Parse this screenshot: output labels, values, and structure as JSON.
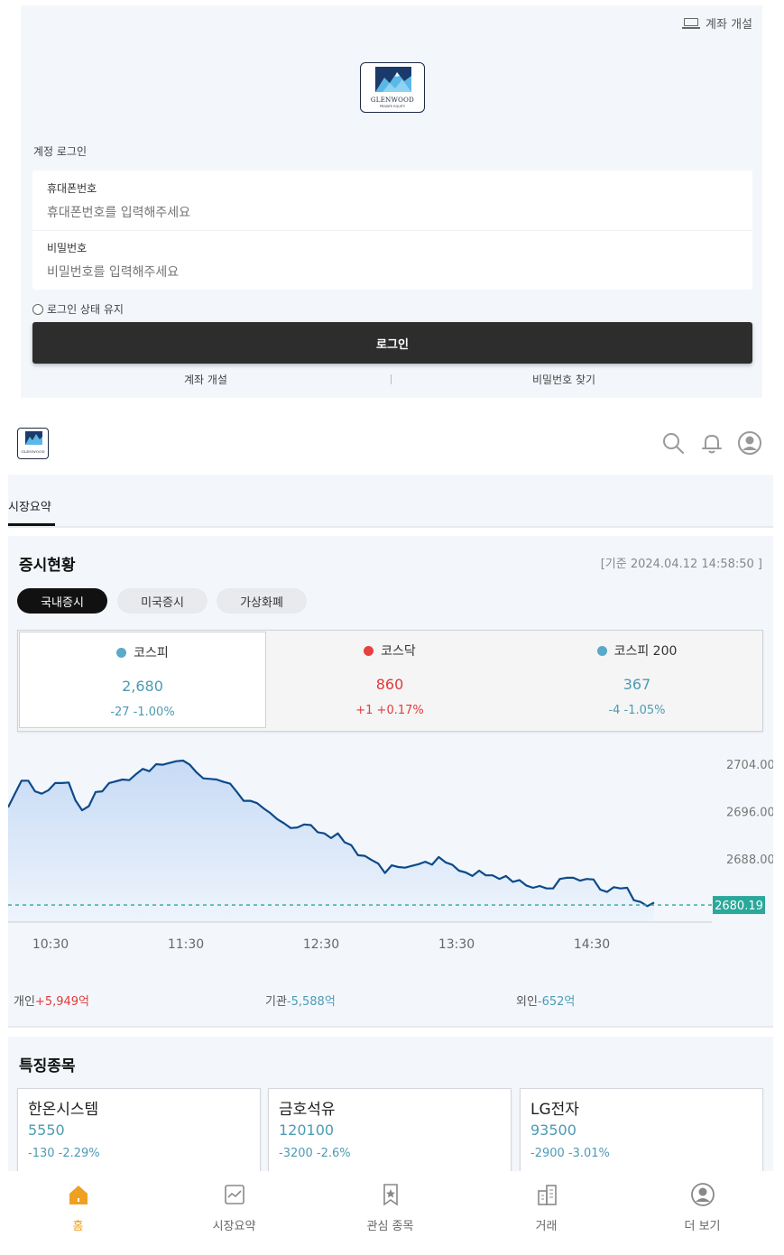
{
  "login": {
    "open_account_top": "계좌 개설",
    "logo_text": "GLENWOOD",
    "logo_subtext": "PRIVATE EQUITY",
    "heading": "계정 로그인",
    "phone_label": "휴대폰번호",
    "phone_placeholder": "휴대폰번호를 입력해주세요",
    "password_label": "비밀번호",
    "password_placeholder": "비밀번호를 입력해주세요",
    "keep_login": "로그인 상태 유지",
    "login_button": "로그인",
    "open_account_link": "계좌 개설",
    "find_password_link": "비밀번호 찾기"
  },
  "tabs": {
    "market_summary": "시장요약"
  },
  "market": {
    "title": "증시현황",
    "timestamp": "[기준 2024.04.12 14:58:50 ]",
    "pills": [
      "국내증시",
      "미국증시",
      "가상화폐"
    ],
    "indices": [
      {
        "name": "코스피",
        "value": "2,680",
        "change": "-27 -1.00%",
        "color": "#5aa9c9"
      },
      {
        "name": "코스닥",
        "value": "860",
        "change": "+1 +0.17%",
        "color": "#e84040"
      },
      {
        "name": "코스피 200",
        "value": "367",
        "change": "-4 -1.05%",
        "color": "#5aa9c9"
      }
    ],
    "flows": {
      "individual_label": "개인",
      "individual_value": "+5,949억",
      "institution_label": "기관",
      "institution_value": "-5,588억",
      "foreign_label": "외인",
      "foreign_value": "-652억"
    }
  },
  "chart_data": {
    "type": "area",
    "x_ticks": [
      "10:30",
      "11:30",
      "12:30",
      "13:30",
      "14:30"
    ],
    "y_ticks": [
      "2704.00",
      "2696.00",
      "2688.00"
    ],
    "ylim": [
      2677.0,
      2707.5
    ],
    "current_value": "2680.19",
    "current_value_numeric": 2680.19,
    "series": [
      {
        "values": [
          2696.7,
          2699.0,
          2701.2,
          2701.2,
          2699.4,
          2699.0,
          2699.6,
          2700.8,
          2700.8,
          2700.9,
          2697.9,
          2696.2,
          2696.9,
          2699.3,
          2699.4,
          2700.8,
          2701.1,
          2701.4,
          2701.3,
          2702.3,
          2703.2,
          2702.8,
          2704.0,
          2703.9,
          2704.2,
          2704.5,
          2704.6,
          2703.9,
          2702.6,
          2701.6,
          2701.5,
          2701.4,
          2701.0,
          2700.7,
          2699.3,
          2697.8,
          2697.8,
          2697.4,
          2696.5,
          2695.7,
          2694.7,
          2694.0,
          2693.2,
          2693.3,
          2693.8,
          2693.7,
          2692.5,
          2692.3,
          2691.5,
          2692.3,
          2690.8,
          2690.3,
          2688.6,
          2688.5,
          2687.8,
          2687.2,
          2685.6,
          2686.9,
          2686.6,
          2686.5,
          2686.8,
          2687.1,
          2687.5,
          2687.0,
          2688.3,
          2687.4,
          2687.0,
          2686.0,
          2685.7,
          2685.1,
          2686.0,
          2685.2,
          2685.2,
          2684.6,
          2685.1,
          2684.1,
          2684.4,
          2683.5,
          2683.1,
          2683.4,
          2683.0,
          2683.0,
          2684.6,
          2684.8,
          2684.8,
          2684.3,
          2684.6,
          2684.5,
          2682.8,
          2682.4,
          2683.2,
          2683.0,
          2683.1,
          2681.0,
          2680.7,
          2680.0,
          2680.6
        ]
      }
    ]
  },
  "featured": {
    "title": "특징종목",
    "stocks": [
      {
        "name": "한온시스템",
        "price": "5550",
        "change": "-130 -2.29%"
      },
      {
        "name": "금호석유",
        "price": "120100",
        "change": "-3200 -2.6%"
      },
      {
        "name": "LG전자",
        "price": "93500",
        "change": "-2900 -3.01%"
      }
    ]
  },
  "bottom_nav": {
    "home": "홈",
    "market": "시장요약",
    "watchlist": "관심 종목",
    "trade": "거래",
    "more": "더 보기",
    "active_color": "#f0a020"
  }
}
